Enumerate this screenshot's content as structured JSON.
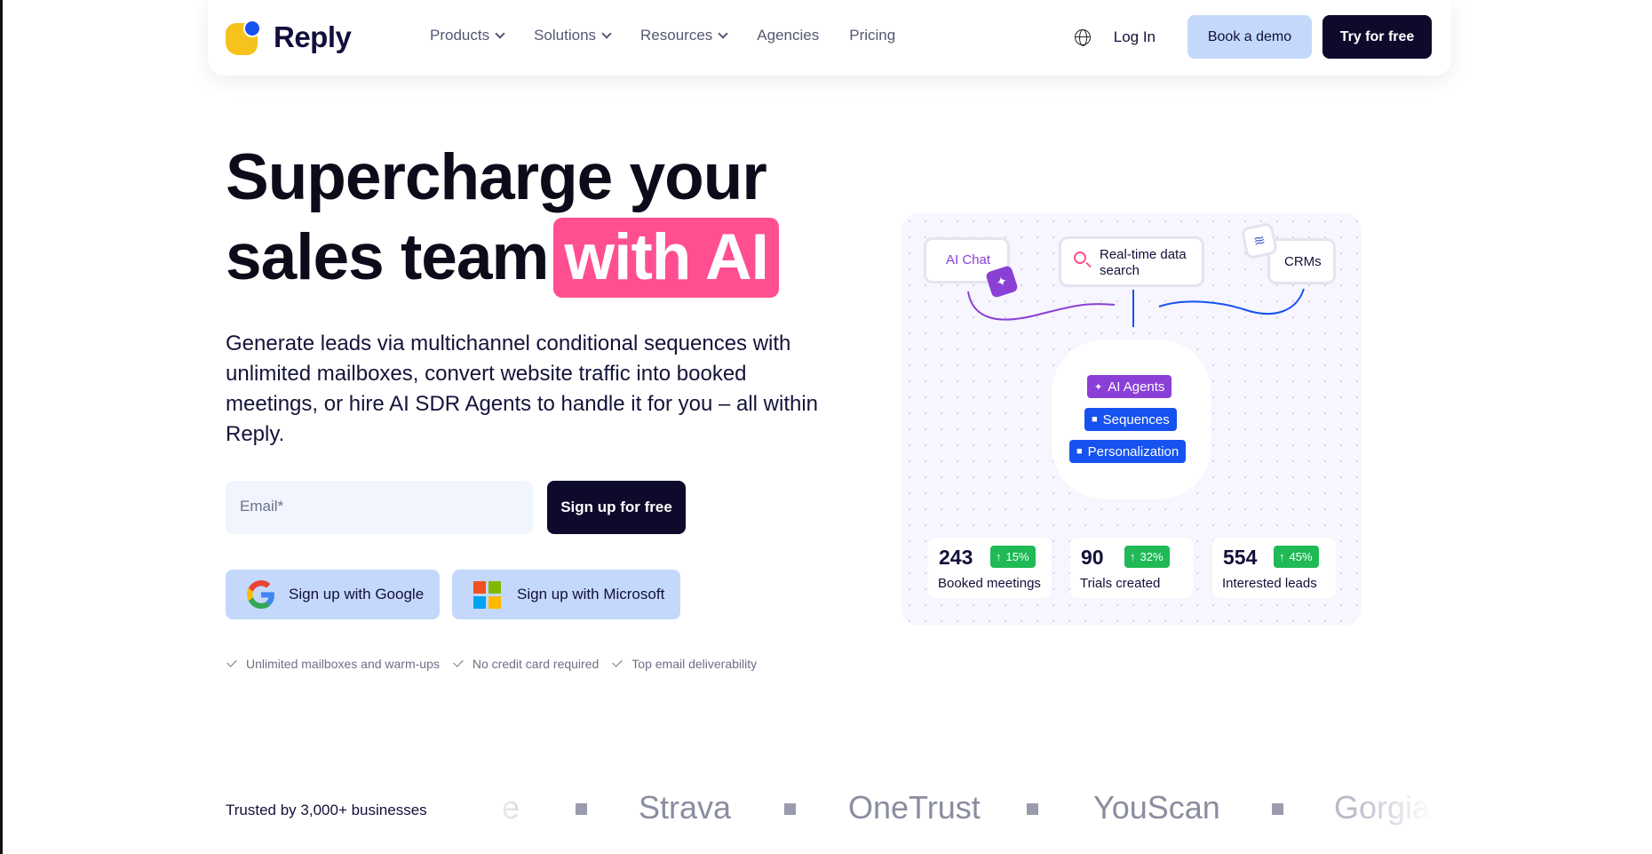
{
  "nav": {
    "brand": "Reply",
    "menu": [
      {
        "label": "Products",
        "has_dropdown": true
      },
      {
        "label": "Solutions",
        "has_dropdown": true
      },
      {
        "label": "Resources",
        "has_dropdown": true
      },
      {
        "label": "Agencies",
        "has_dropdown": false
      },
      {
        "label": "Pricing",
        "has_dropdown": false
      }
    ],
    "language_icon": "globe-icon",
    "login": "Log In",
    "book_demo": "Book a demo",
    "try_free": "Try for free"
  },
  "hero": {
    "headline_line1": "Supercharge your",
    "headline_line2": "sales team",
    "headline_highlight": "with AI",
    "subtitle": "Generate leads via multichannel conditional sequences with unlimited mailboxes, convert website traffic into booked meetings, or hire AI SDR Agents to handle it for you – all within Reply.",
    "email_placeholder": "Email*",
    "signup_button": "Sign up for free",
    "google_button": "Sign up with Google",
    "microsoft_button": "Sign up with Microsoft",
    "benefits": [
      "Unlimited mailboxes and warm-ups",
      "No credit card required",
      "Top email deliverability"
    ]
  },
  "illustration": {
    "ai_chat": "AI Chat",
    "realtime": "Real-time data search",
    "crms": "CRMs",
    "pills": [
      "AI Agents",
      "Sequences",
      "Personalization"
    ],
    "stats": [
      {
        "value": "243",
        "change": "15%",
        "label": "Booked meetings"
      },
      {
        "value": "90",
        "change": "32%",
        "label": "Trials created"
      },
      {
        "value": "554",
        "change": "45%",
        "label": "Interested leads"
      }
    ],
    "colors": {
      "purple": "#8a3fd6",
      "blue": "#1652f0",
      "green": "#1fb955",
      "pink": "#ff4f91"
    }
  },
  "trusted": {
    "label": "Trusted by 3,000+ businesses",
    "logos": [
      "e",
      "Strava",
      "OneTrust",
      "YouScan",
      "Gorgia"
    ]
  }
}
